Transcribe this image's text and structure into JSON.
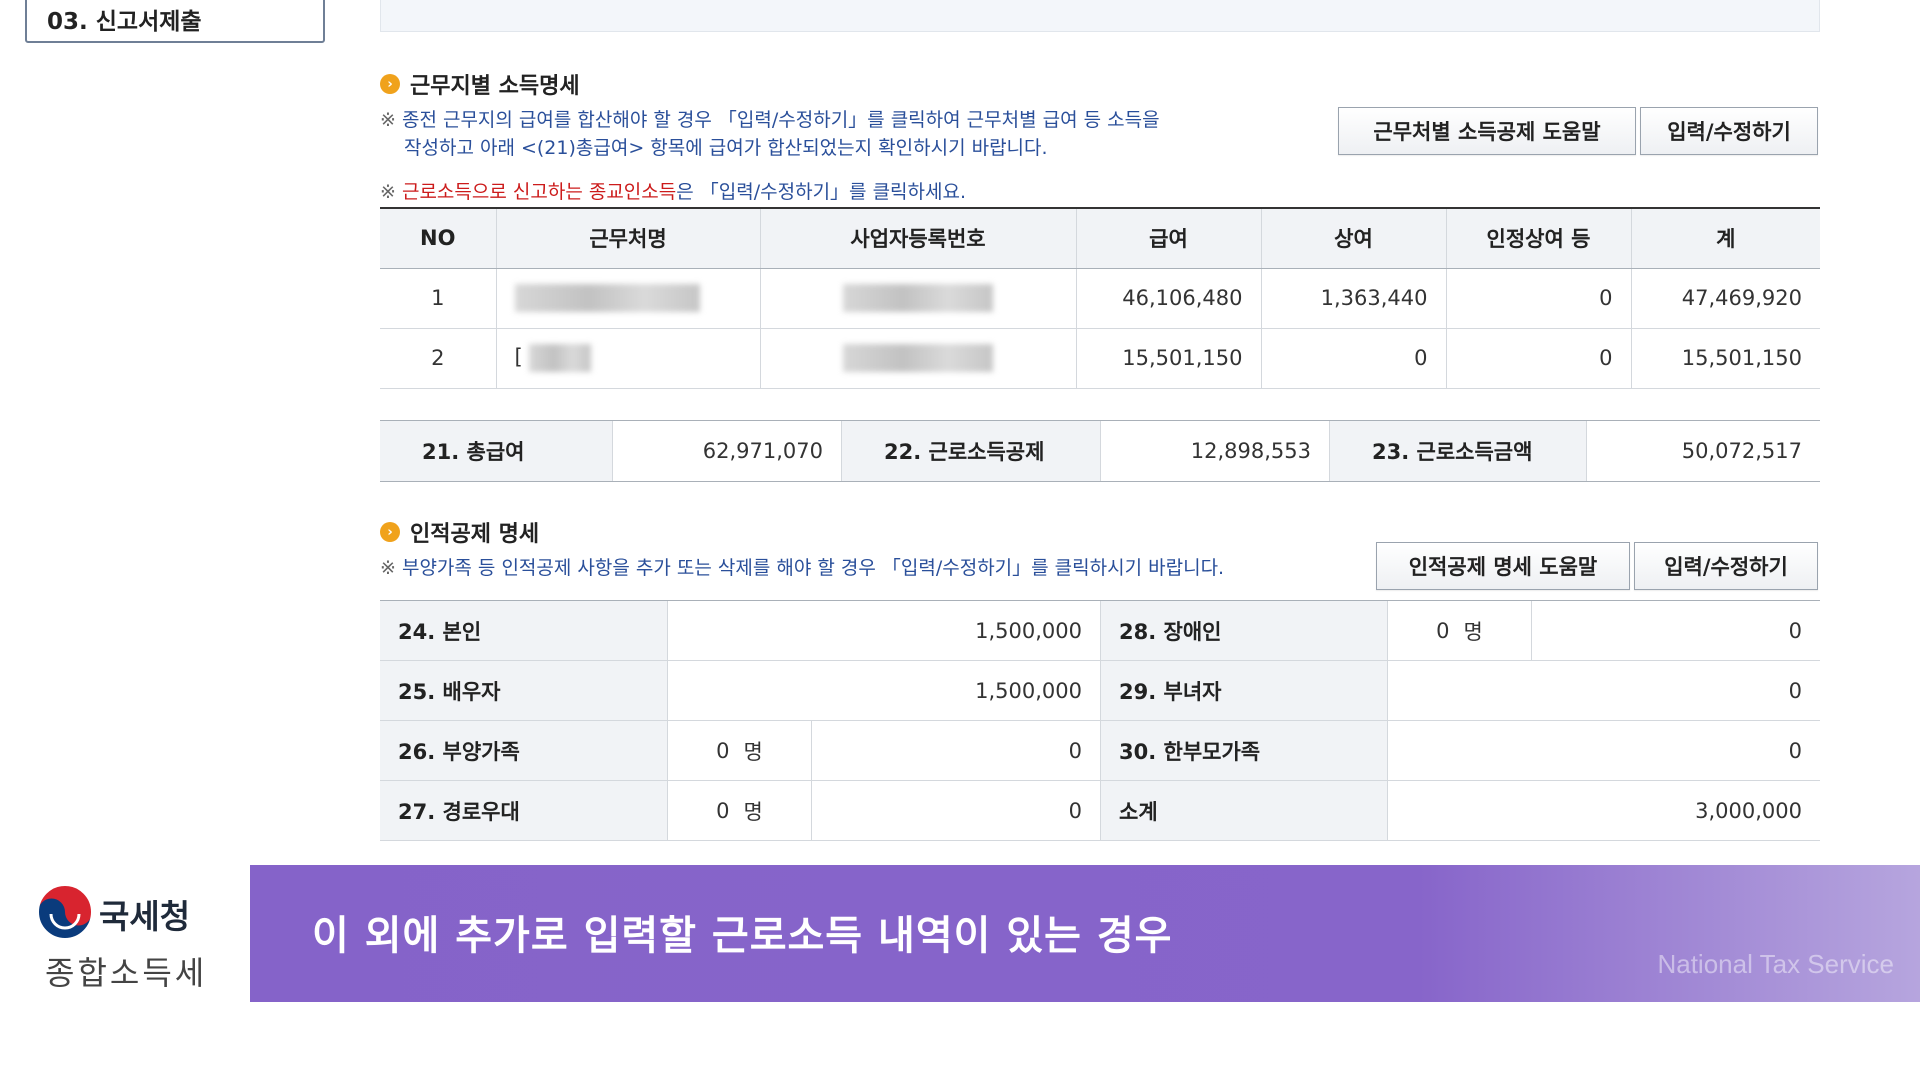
{
  "step": {
    "label": "03. 신고서제출"
  },
  "work_section": {
    "title": "근무지별 소득명세",
    "note1_line1": "종전 근무지의 급여를 합산해야 할 경우 「입력/수정하기」를 클릭하여 근무처별 급여 등 소득을",
    "note1_line2": "작성하고 아래 <(21)총급여> 항목에 급여가 합산되었는지 확인하시기 바랍니다.",
    "note2_red": "근로소득으로 신고하는 종교인소득",
    "note2_rest": "은 「입력/수정하기」를 클릭하세요.",
    "mark": "※",
    "help_button": "근무처별 소득공제 도움말",
    "edit_button": "입력/수정하기",
    "headers": [
      "NO",
      "근무처명",
      "사업자등록번호",
      "급여",
      "상여",
      "인정상여 등",
      "계"
    ],
    "rows": [
      {
        "no": "1",
        "salary": "46,106,480",
        "bonus": "1,363,440",
        "recognized": "0",
        "total": "47,469,920"
      },
      {
        "no": "2",
        "name_fragment": "[",
        "salary": "15,501,150",
        "bonus": "0",
        "recognized": "0",
        "total": "15,501,150"
      }
    ]
  },
  "summary": {
    "total_salary_label": "21. 총급여",
    "total_salary_value": "62,971,070",
    "deduction_label": "22. 근로소득공제",
    "deduction_value": "12,898,553",
    "income_label": "23. 근로소득금액",
    "income_value": "50,072,517"
  },
  "personal_section": {
    "title": "인적공제 명세",
    "note": "부양가족 등 인적공제 사항을 추가 또는 삭제를 해야 할 경우 「입력/수정하기」를 클릭하시기 바랍니다.",
    "mark": "※",
    "help_button": "인적공제 명세 도움말",
    "edit_button": "입력/수정하기",
    "unit": "명",
    "self_label": "24. 본인",
    "self_value": "1,500,000",
    "spouse_label": "25. 배우자",
    "spouse_value": "1,500,000",
    "dependents_label": "26. 부양가족",
    "dependents_count": "0",
    "dependents_value": "0",
    "elderly_label": "27. 경로우대",
    "elderly_count": "0",
    "elderly_value": "0",
    "disabled_label": "28. 장애인",
    "disabled_count": "0",
    "disabled_value": "0",
    "female_label": "29. 부녀자",
    "female_value": "0",
    "single_parent_label": "30. 한부모가족",
    "single_parent_value": "0",
    "subtotal_label": "소계",
    "subtotal_value": "3,000,000"
  },
  "logo": {
    "title": "국세청",
    "subtitle": "종합소득세"
  },
  "banner": {
    "text": "이 외에 추가로 입력할 근로소득 내역이 있는 경우",
    "brand": "National Tax Service"
  },
  "colors": {
    "accent_purple": "#8563c9",
    "note_blue": "#2a4f9a",
    "note_red": "#cc1b1b",
    "bullet_orange": "#f0a21c"
  }
}
